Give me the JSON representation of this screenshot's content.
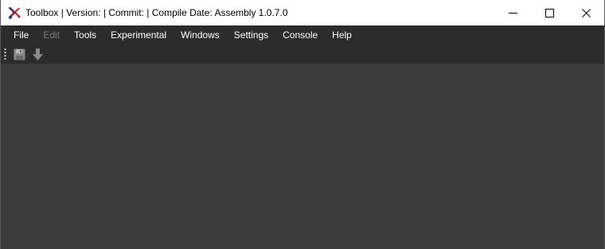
{
  "window": {
    "title": "Toolbox | Version:  | Commit:  | Compile Date:  Assembly 1.0.7.0",
    "controls": {
      "minimize": "minimize-icon",
      "maximize": "maximize-icon",
      "close": "close-icon"
    }
  },
  "menu": {
    "items": [
      {
        "label": "File",
        "enabled": true
      },
      {
        "label": "Edit",
        "enabled": false
      },
      {
        "label": "Tools",
        "enabled": true
      },
      {
        "label": "Experimental",
        "enabled": true
      },
      {
        "label": "Windows",
        "enabled": true
      },
      {
        "label": "Settings",
        "enabled": true
      },
      {
        "label": "Console",
        "enabled": true
      },
      {
        "label": "Help",
        "enabled": true
      }
    ]
  },
  "toolbar": {
    "buttons": [
      {
        "icon": "save-icon"
      },
      {
        "icon": "download-arrow-icon"
      }
    ]
  },
  "colors": {
    "titlebar": "#ffffff",
    "menubar": "#2c2c2c",
    "workspace": "#3c3c3c",
    "menu_text": "#ffffff",
    "menu_text_disabled": "#7a7a7a"
  }
}
